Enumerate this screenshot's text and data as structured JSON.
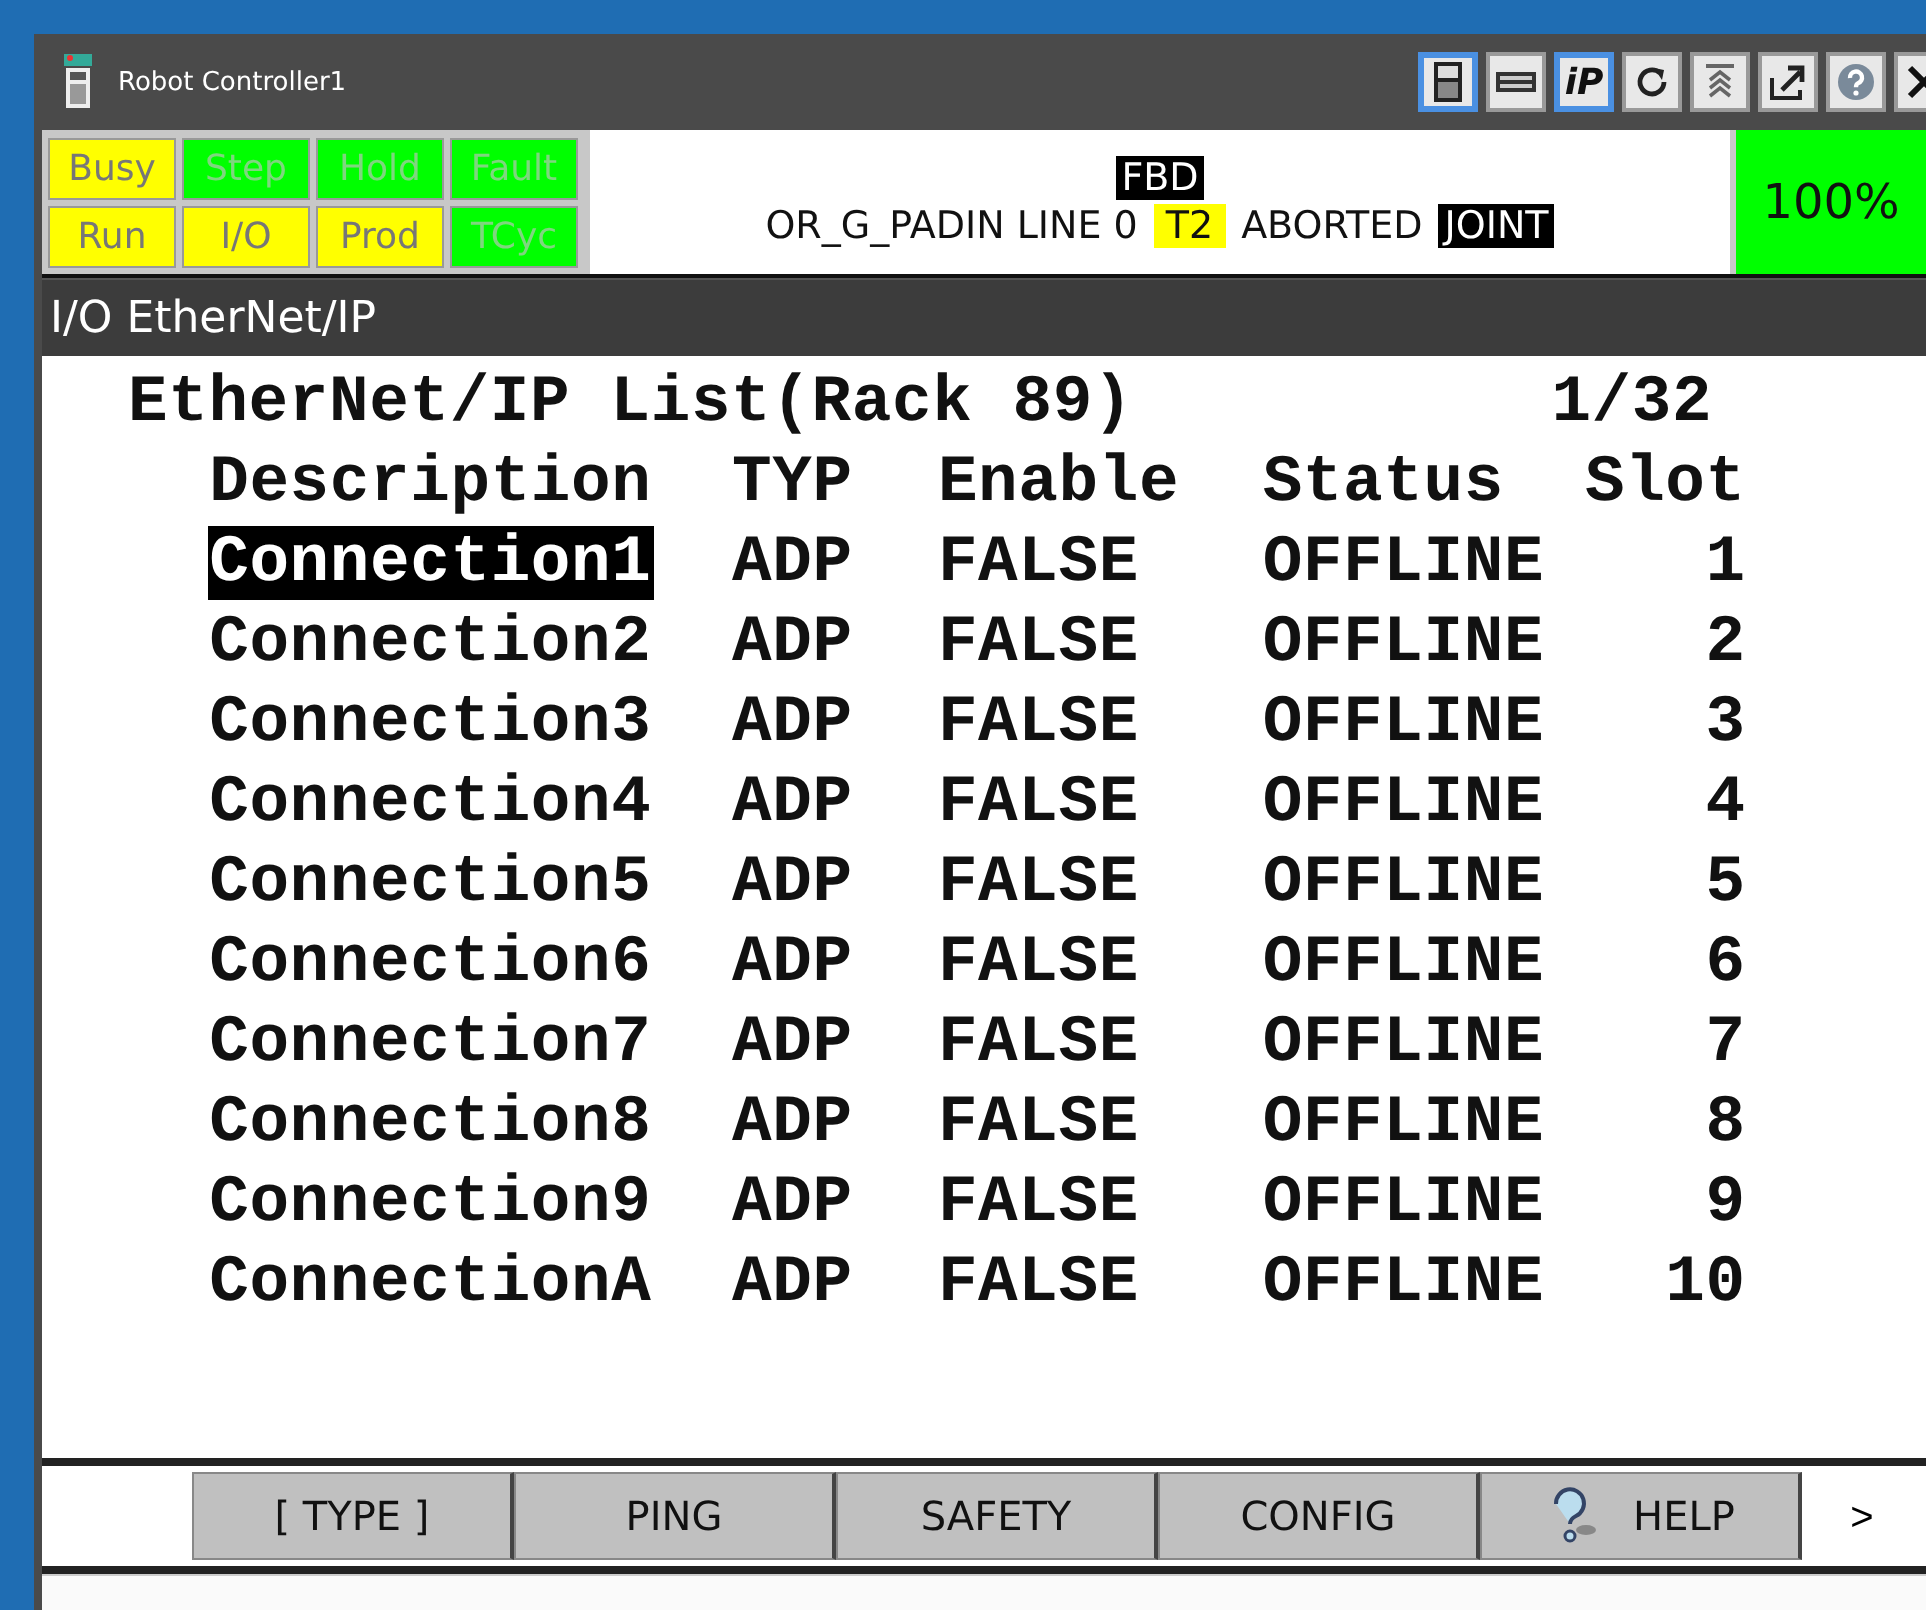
{
  "window": {
    "title": "Robot Controller1"
  },
  "toolbar": [
    {
      "kind": "pendant",
      "selected": true
    },
    {
      "kind": "keyboard",
      "selected": false
    },
    {
      "kind": "ip",
      "label": "iP",
      "selected": true
    },
    {
      "kind": "refresh",
      "selected": false
    },
    {
      "kind": "jog",
      "selected": false
    },
    {
      "kind": "popout",
      "selected": false
    },
    {
      "kind": "help",
      "selected": false
    },
    {
      "kind": "close",
      "selected": false
    }
  ],
  "indicators": [
    {
      "label": "Busy",
      "on": true
    },
    {
      "label": "Step",
      "on": false
    },
    {
      "label": "Hold",
      "on": false
    },
    {
      "label": "Fault",
      "on": false
    },
    {
      "label": "Run",
      "on": true
    },
    {
      "label": "I/O",
      "on": true
    },
    {
      "label": "Prod",
      "on": true
    },
    {
      "label": "TCyc",
      "on": false
    }
  ],
  "status": {
    "mode": "FBD",
    "program": "OR_G_PADIN LINE 0",
    "teach": "T2",
    "state": "ABORTED",
    "coord": "JOINT",
    "override": "100%"
  },
  "screen": {
    "title": "I/O EtherNet/IP",
    "heading": "EtherNet/IP List(Rack 89)",
    "page": "1/32",
    "columns": [
      "Description",
      "TYP",
      "Enable",
      "Status",
      "Slot"
    ],
    "rows": [
      {
        "description": "Connection1",
        "typ": "ADP",
        "enable": "FALSE",
        "status": "OFFLINE",
        "slot": "1",
        "selected": true
      },
      {
        "description": "Connection2",
        "typ": "ADP",
        "enable": "FALSE",
        "status": "OFFLINE",
        "slot": "2",
        "selected": false
      },
      {
        "description": "Connection3",
        "typ": "ADP",
        "enable": "FALSE",
        "status": "OFFLINE",
        "slot": "3",
        "selected": false
      },
      {
        "description": "Connection4",
        "typ": "ADP",
        "enable": "FALSE",
        "status": "OFFLINE",
        "slot": "4",
        "selected": false
      },
      {
        "description": "Connection5",
        "typ": "ADP",
        "enable": "FALSE",
        "status": "OFFLINE",
        "slot": "5",
        "selected": false
      },
      {
        "description": "Connection6",
        "typ": "ADP",
        "enable": "FALSE",
        "status": "OFFLINE",
        "slot": "6",
        "selected": false
      },
      {
        "description": "Connection7",
        "typ": "ADP",
        "enable": "FALSE",
        "status": "OFFLINE",
        "slot": "7",
        "selected": false
      },
      {
        "description": "Connection8",
        "typ": "ADP",
        "enable": "FALSE",
        "status": "OFFLINE",
        "slot": "8",
        "selected": false
      },
      {
        "description": "Connection9",
        "typ": "ADP",
        "enable": "FALSE",
        "status": "OFFLINE",
        "slot": "9",
        "selected": false
      },
      {
        "description": "ConnectionA",
        "typ": "ADP",
        "enable": "FALSE",
        "status": "OFFLINE",
        "slot": "10",
        "selected": false
      }
    ]
  },
  "function_keys": [
    {
      "label": "[ TYPE ]",
      "kind": "plain"
    },
    {
      "label": "PING",
      "kind": "plain"
    },
    {
      "label": "SAFETY",
      "kind": "plain"
    },
    {
      "label": "CONFIG",
      "kind": "plain"
    },
    {
      "label": "HELP",
      "kind": "help"
    }
  ],
  "next_key": ">"
}
